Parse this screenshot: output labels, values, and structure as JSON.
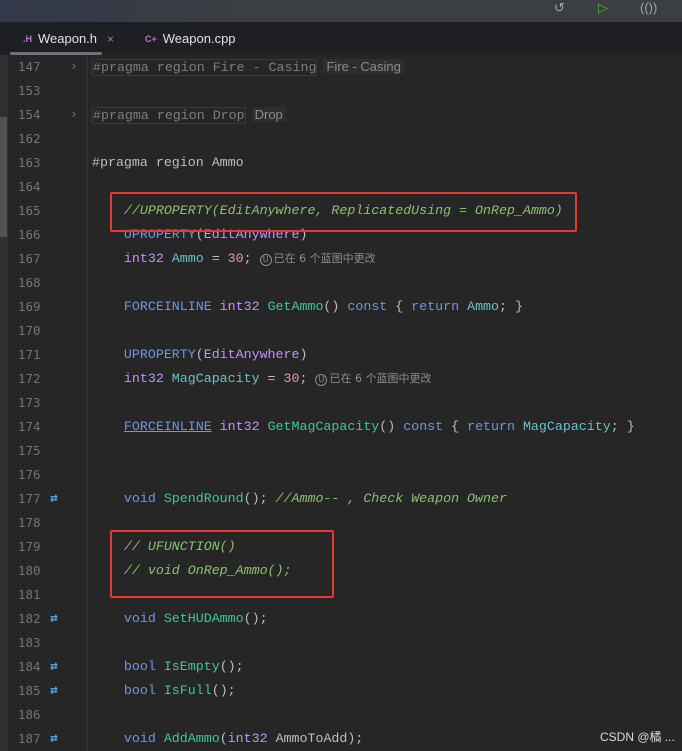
{
  "tabs": [
    {
      "icon": ".H",
      "label": "Weapon.h",
      "active": true,
      "close": "×"
    },
    {
      "icon": "C+",
      "label": "Weapon.cpp",
      "active": false
    }
  ],
  "hint_text": "已在 6 个蓝图中更改",
  "watermark": "CSDN @橘 ...",
  "lines": [
    {
      "n": "147",
      "g": "fold",
      "t": [
        [
          "#pragma region Fire - Casing",
          "fold-t"
        ]
      ],
      "lbl": "Fire - Casing"
    },
    {
      "n": "153",
      "t": []
    },
    {
      "n": "154",
      "g": "fold",
      "t": [
        [
          "#pragma region Drop",
          "fold-t"
        ]
      ],
      "lbl": "Drop"
    },
    {
      "n": "162",
      "t": []
    },
    {
      "n": "163",
      "t": [
        [
          "#pragma region ",
          "pl"
        ],
        [
          "Ammo",
          "pl"
        ]
      ]
    },
    {
      "n": "164",
      "t": []
    },
    {
      "n": "165",
      "t": [
        [
          "    //UPROPERTY(EditAnywhere, ReplicatedUsing = OnRep_Ammo)",
          "cm"
        ]
      ]
    },
    {
      "n": "166",
      "t": [
        [
          "    UPROPERTY",
          "mac"
        ],
        [
          "(",
          "pl"
        ],
        [
          "EditAnywhere",
          "ty"
        ],
        [
          ")",
          "pl"
        ]
      ]
    },
    {
      "n": "167",
      "t": [
        [
          "    int32 ",
          "ty"
        ],
        [
          "Ammo",
          "fd"
        ],
        [
          " = ",
          "pl"
        ],
        [
          "30",
          "nm"
        ],
        [
          ";",
          "pl"
        ]
      ],
      "hint": true
    },
    {
      "n": "168",
      "t": []
    },
    {
      "n": "169",
      "t": [
        [
          "    FORCEINLINE ",
          "mac"
        ],
        [
          "int32 ",
          "ty"
        ],
        [
          "GetAmmo",
          "fn"
        ],
        [
          "() ",
          "pl"
        ],
        [
          "const",
          "kw"
        ],
        [
          " { ",
          "pl"
        ],
        [
          "return ",
          "kw"
        ],
        [
          "Ammo",
          "fd"
        ],
        [
          "; }",
          "pl"
        ]
      ]
    },
    {
      "n": "170",
      "t": []
    },
    {
      "n": "171",
      "t": [
        [
          "    UPROPERTY",
          "mac"
        ],
        [
          "(",
          "pl"
        ],
        [
          "EditAnywhere",
          "ty"
        ],
        [
          ")",
          "pl"
        ]
      ]
    },
    {
      "n": "172",
      "t": [
        [
          "    int32 ",
          "ty"
        ],
        [
          "MagCapacity",
          "fd"
        ],
        [
          " = ",
          "pl"
        ],
        [
          "30",
          "nm"
        ],
        [
          ";",
          "pl"
        ]
      ],
      "hint": true
    },
    {
      "n": "173",
      "t": []
    },
    {
      "n": "174",
      "t": [
        [
          "    ",
          "pl"
        ],
        [
          "FORCEINLINE",
          "mac ul"
        ],
        [
          " int32 ",
          "ty"
        ],
        [
          "GetMagCapacity",
          "fn"
        ],
        [
          "() ",
          "pl"
        ],
        [
          "const",
          "kw"
        ],
        [
          " { ",
          "pl"
        ],
        [
          "return ",
          "kw"
        ],
        [
          "MagCapacity",
          "fd"
        ],
        [
          "; }",
          "pl"
        ]
      ]
    },
    {
      "n": "175",
      "t": []
    },
    {
      "n": "176",
      "t": []
    },
    {
      "n": "177",
      "g": "sw",
      "t": [
        [
          "    void ",
          "kw"
        ],
        [
          "SpendRound",
          "fn"
        ],
        [
          "(); ",
          "pl"
        ],
        [
          "//Ammo-- , Check Weapon Owner",
          "cm"
        ]
      ]
    },
    {
      "n": "178",
      "t": []
    },
    {
      "n": "179",
      "t": [
        [
          "    // UFUNCTION()",
          "cm"
        ]
      ]
    },
    {
      "n": "180",
      "t": [
        [
          "    // void OnRep_Ammo();",
          "cm"
        ]
      ]
    },
    {
      "n": "181",
      "t": []
    },
    {
      "n": "182",
      "g": "sw",
      "t": [
        [
          "    void ",
          "kw"
        ],
        [
          "SetHUDAmmo",
          "fn"
        ],
        [
          "();",
          "pl"
        ]
      ]
    },
    {
      "n": "183",
      "t": []
    },
    {
      "n": "184",
      "g": "sw",
      "t": [
        [
          "    bool ",
          "kw"
        ],
        [
          "IsEmpty",
          "fn"
        ],
        [
          "();",
          "pl"
        ]
      ]
    },
    {
      "n": "185",
      "g": "sw",
      "t": [
        [
          "    bool ",
          "kw"
        ],
        [
          "IsFull",
          "fn"
        ],
        [
          "();",
          "pl"
        ]
      ]
    },
    {
      "n": "186",
      "t": []
    },
    {
      "n": "187",
      "g": "sw",
      "t": [
        [
          "    void ",
          "kw"
        ],
        [
          "AddAmmo",
          "fn"
        ],
        [
          "(",
          "pl"
        ],
        [
          "int32 ",
          "ty"
        ],
        [
          "AmmoToAdd",
          "pl"
        ],
        [
          ");",
          "pl"
        ]
      ]
    }
  ]
}
